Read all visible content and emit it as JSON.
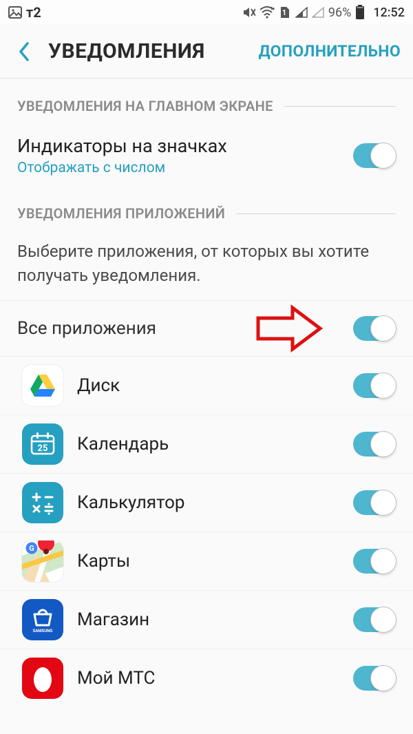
{
  "statusbar": {
    "carrier": "т2",
    "battery_percent": "96%",
    "time": "12:52",
    "sim_badge": "1"
  },
  "toolbar": {
    "title": "УВЕДОМЛЕНИЯ",
    "action": "ДОПОЛНИТЕЛЬНО"
  },
  "section1": {
    "header": "УВЕДОМЛЕНИЯ НА ГЛАВНОМ ЭКРАНЕ",
    "row1_main": "Индикаторы на значках",
    "row1_sub": "Отображать с числом",
    "row1_on": true
  },
  "section2": {
    "header": "УВЕДОМЛЕНИЯ ПРИЛОЖЕНИЙ",
    "description": "Выберите приложения, от которых вы хотите получать уведомления.",
    "all_apps_label": "Все приложения",
    "all_apps_on": true
  },
  "apps": [
    {
      "name": "Диск",
      "on": true,
      "icon": "drive"
    },
    {
      "name": "Календарь",
      "on": true,
      "icon": "calendar",
      "cal_num": "25"
    },
    {
      "name": "Калькулятор",
      "on": true,
      "icon": "calculator"
    },
    {
      "name": "Карты",
      "on": true,
      "icon": "maps"
    },
    {
      "name": "Магазин",
      "on": true,
      "icon": "store"
    },
    {
      "name": "Мой МТС",
      "on": true,
      "icon": "mts"
    }
  ]
}
